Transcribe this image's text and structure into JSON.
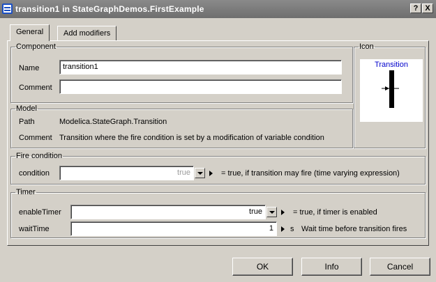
{
  "window": {
    "title": "transition1 in StateGraphDemos.FirstExample",
    "help_label": "?",
    "close_label": "X"
  },
  "tabs": [
    {
      "label": "General",
      "active": true
    },
    {
      "label": "Add modifiers",
      "active": false
    }
  ],
  "component": {
    "legend": "Component",
    "name_label": "Name",
    "name_value": "transition1",
    "comment_label": "Comment",
    "comment_value": ""
  },
  "icon_group": {
    "legend": "Icon",
    "icon_title": "Transition",
    "icon_name": "transition-icon"
  },
  "model": {
    "legend": "Model",
    "path_label": "Path",
    "path_value": "Modelica.StateGraph.Transition",
    "comment_label": "Comment",
    "comment_value": "Transition where the fire condition is set by a modification of variable condition"
  },
  "fire_condition": {
    "legend": "Fire condition",
    "condition_label": "condition",
    "condition_value": "true",
    "condition_desc": "= true, if transition may fire (time varying expression)"
  },
  "timer": {
    "legend": "Timer",
    "enable_label": "enableTimer",
    "enable_value": "true",
    "enable_desc": "= true, if timer is enabled",
    "wait_label": "waitTime",
    "wait_value": "1",
    "wait_unit": "s",
    "wait_desc": "Wait time before transition fires"
  },
  "buttons": {
    "ok": "OK",
    "info": "Info",
    "cancel": "Cancel"
  },
  "colors": {
    "titlebar": "#7a7a7a",
    "dialog": "#d4d0c8",
    "icon_text": "#0000cc"
  }
}
